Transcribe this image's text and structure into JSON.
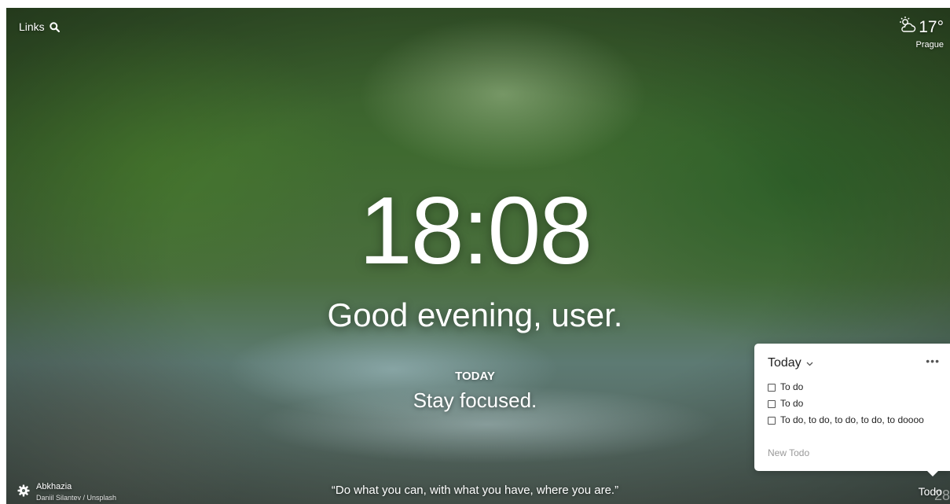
{
  "top_left": {
    "links_label": "Links",
    "search_icon": "search-icon"
  },
  "weather": {
    "icon": "partly-cloudy-icon",
    "temperature": "17°",
    "city": "Prague"
  },
  "center": {
    "time": "18:08",
    "greeting": "Good evening, user.",
    "focus_label": "TODAY",
    "focus_text": "Stay focused."
  },
  "bottom": {
    "quote": "“Do what you can, with what you have, where you are.”",
    "settings_icon": "gear-icon",
    "photo_location": "Abkhazia",
    "photo_credit": "Daniil Silantev / Unsplash",
    "todo_toggle": "Todo",
    "page_number": "28"
  },
  "todo_panel": {
    "list_name": "Today",
    "more_icon": "more-icon",
    "items": [
      {
        "text": "To do"
      },
      {
        "text": "To do"
      },
      {
        "text": "To do, to do, to do, to do, to doooo"
      }
    ],
    "new_todo_placeholder": "New Todo"
  }
}
